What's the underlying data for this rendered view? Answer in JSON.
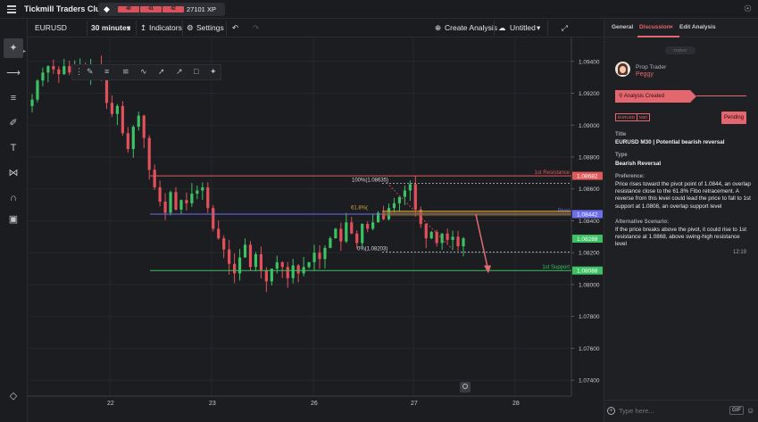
{
  "app": {
    "title": "Tickmill Traders Club",
    "xp": "27101 XP",
    "levels": [
      "40",
      "41",
      "42"
    ]
  },
  "toolbar": {
    "symbol": "EURUSD",
    "interval": "30 minutes",
    "indicators": "Indicators",
    "settings": "Settings",
    "create_analysis": "Create Analysis",
    "untitled": "Untitled"
  },
  "left_tools": [
    "crosshair-icon",
    "horizontal-line-icon",
    "fib-icon",
    "brush-icon",
    "text-icon",
    "pattern-icon",
    "magnet-icon",
    "trash-icon",
    "layers-icon"
  ],
  "panel": {
    "tabs": [
      {
        "label": "General"
      },
      {
        "label": "Discussion"
      },
      {
        "label": "Edit Analysis"
      }
    ],
    "close_glyph": "×",
    "today": "TODAY",
    "role": "Prop Trader",
    "user": "Peggy",
    "created": "Analysis Created",
    "tags": [
      "EURUSD",
      "M30"
    ],
    "status": "Pending",
    "title_label": "Title",
    "title_value": "EURUSD M30 | Potential bearish reversal",
    "type_label": "Type",
    "type_value": "Bearish Reversal",
    "preference_label": "Preference:",
    "preference_text": "Price rises toward the pivot point of 1.0844, an overlap resistance close to the 61.8% Fibo retracement. A reverse from this level could lead the price to fall to 1st support at 1.0808, an overlap support level",
    "alt_label": "Alternative Scenario:",
    "alt_text": "If the price breaks above the pivot, it could rise to 1st resistance at 1.0868, above swing-high resistance level",
    "time": "12:19",
    "composer_placeholder": "Type here...",
    "gif": "GIF"
  },
  "chart_data": {
    "type": "candlestick",
    "symbol": "EURUSD",
    "interval": "30 minutes",
    "ylim": [
      1.073,
      1.0955
    ],
    "y_ticks": [
      "1.09400",
      "1.09200",
      "1.09000",
      "1.08800",
      "1.08600",
      "1.08400",
      "1.08200",
      "1.08000",
      "1.07800",
      "1.07600",
      "1.07400"
    ],
    "x_ticks": [
      "22",
      "23",
      "26",
      "27",
      "28"
    ],
    "levels": [
      {
        "name": "1st Resistance",
        "value": 1.08682,
        "label": "1.08682",
        "color": "#e05a5a"
      },
      {
        "name": "Pivot",
        "value": 1.08442,
        "label": "1.08442",
        "color": "#6b6ef0"
      },
      {
        "name": "1st Support",
        "value": 1.08088,
        "label": "1.08088",
        "color": "#3cc163"
      }
    ],
    "current_price": {
      "value": 1.08288,
      "label": "1.08288"
    },
    "fibonacci": [
      {
        "label": "100%(1.08635)",
        "value": 1.08635
      },
      {
        "label": "61.8%(",
        "value": 1.0846
      },
      {
        "label": "0%(1.08203)",
        "value": 1.08203
      }
    ],
    "closes": [
      1.0916,
      1.0928,
      1.0933,
      1.0937,
      1.0935,
      1.0932,
      1.0937,
      1.0933,
      1.0936,
      1.0938,
      1.0932,
      1.0935,
      1.0937,
      1.0929,
      1.0914,
      1.0907,
      1.0912,
      1.0895,
      1.0885,
      1.0899,
      1.0906,
      1.0892,
      1.0872,
      1.0861,
      1.0852,
      1.0845,
      1.0858,
      1.0847,
      1.0853,
      1.0851,
      1.0857,
      1.0859,
      1.0861,
      1.0848,
      1.0835,
      1.0829,
      1.0822,
      1.0813,
      1.0807,
      1.0817,
      1.0825,
      1.0811,
      1.0819,
      1.0809,
      1.0802,
      1.081,
      1.0814,
      1.0811,
      1.0804,
      1.0812,
      1.0807,
      1.0811,
      1.0814,
      1.082,
      1.0816,
      1.0823,
      1.0829,
      1.0835,
      1.0827,
      1.0839,
      1.0832,
      1.0826,
      1.0838,
      1.0835,
      1.0839,
      1.0845,
      1.0841,
      1.0848,
      1.0851,
      1.0855,
      1.0859,
      1.0863,
      1.0847,
      1.0838,
      1.0829,
      1.0833,
      1.0826,
      1.0832,
      1.0828,
      1.083,
      1.0824,
      1.0829
    ]
  }
}
